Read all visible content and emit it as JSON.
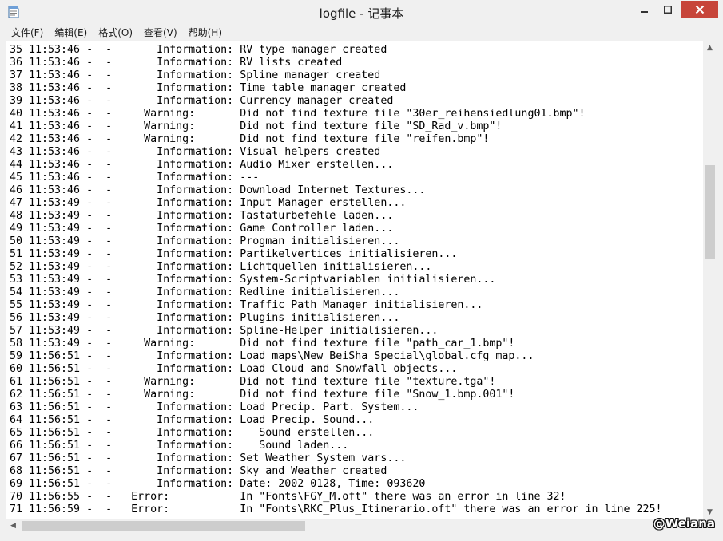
{
  "window": {
    "title": "logfile - 记事本"
  },
  "menu": [
    "文件(F)",
    "编辑(E)",
    "格式(O)",
    "查看(V)",
    "帮助(H)"
  ],
  "lines": [
    "35 11:53:46 -  -       Information: RV type manager created",
    "36 11:53:46 -  -       Information: RV lists created",
    "37 11:53:46 -  -       Information: Spline manager created",
    "38 11:53:46 -  -       Information: Time table manager created",
    "39 11:53:46 -  -       Information: Currency manager created",
    "40 11:53:46 -  -     Warning:       Did not find texture file \"30er_reihensiedlung01.bmp\"!",
    "41 11:53:46 -  -     Warning:       Did not find texture file \"SD_Rad_v.bmp\"!",
    "42 11:53:46 -  -     Warning:       Did not find texture file \"reifen.bmp\"!",
    "43 11:53:46 -  -       Information: Visual helpers created",
    "44 11:53:46 -  -       Information: Audio Mixer erstellen...",
    "45 11:53:46 -  -       Information: ---",
    "46 11:53:46 -  -       Information: Download Internet Textures...",
    "47 11:53:49 -  -       Information: Input Manager erstellen...",
    "48 11:53:49 -  -       Information: Tastaturbefehle laden...",
    "49 11:53:49 -  -       Information: Game Controller laden...",
    "50 11:53:49 -  -       Information: Progman initialisieren...",
    "51 11:53:49 -  -       Information: Partikelvertices initialisieren...",
    "52 11:53:49 -  -       Information: Lichtquellen initialisieren...",
    "53 11:53:49 -  -       Information: System-Scriptvariablen initialisieren...",
    "54 11:53:49 -  -       Information: Redline initialisieren...",
    "55 11:53:49 -  -       Information: Traffic Path Manager initialisieren...",
    "56 11:53:49 -  -       Information: Plugins initialisieren...",
    "57 11:53:49 -  -       Information: Spline-Helper initialisieren...",
    "58 11:53:49 -  -     Warning:       Did not find texture file \"path_car_1.bmp\"!",
    "59 11:56:51 -  -       Information: Load maps\\New BeiSha Special\\global.cfg map...",
    "60 11:56:51 -  -       Information: Load Cloud and Snowfall objects...",
    "61 11:56:51 -  -     Warning:       Did not find texture file \"texture.tga\"!",
    "62 11:56:51 -  -     Warning:       Did not find texture file \"Snow_1.bmp.001\"!",
    "63 11:56:51 -  -       Information: Load Precip. Part. System...",
    "64 11:56:51 -  -       Information: Load Precip. Sound...",
    "65 11:56:51 -  -       Information:    Sound erstellen...",
    "66 11:56:51 -  -       Information:    Sound laden...",
    "67 11:56:51 -  -       Information: Set Weather System vars...",
    "68 11:56:51 -  -       Information: Sky and Weather created",
    "69 11:56:51 -  -       Information: Date: 2002 0128, Time: 093620",
    "70 11:56:55 -  -   Error:           In \"Fonts\\FGY_M.oft\" there was an error in line 32!",
    "71 11:56:59 -  -   Error:           In \"Fonts\\RKC_Plus_Itinerario.oft\" there was an error in line 225!"
  ],
  "watermark": "@Weiana"
}
